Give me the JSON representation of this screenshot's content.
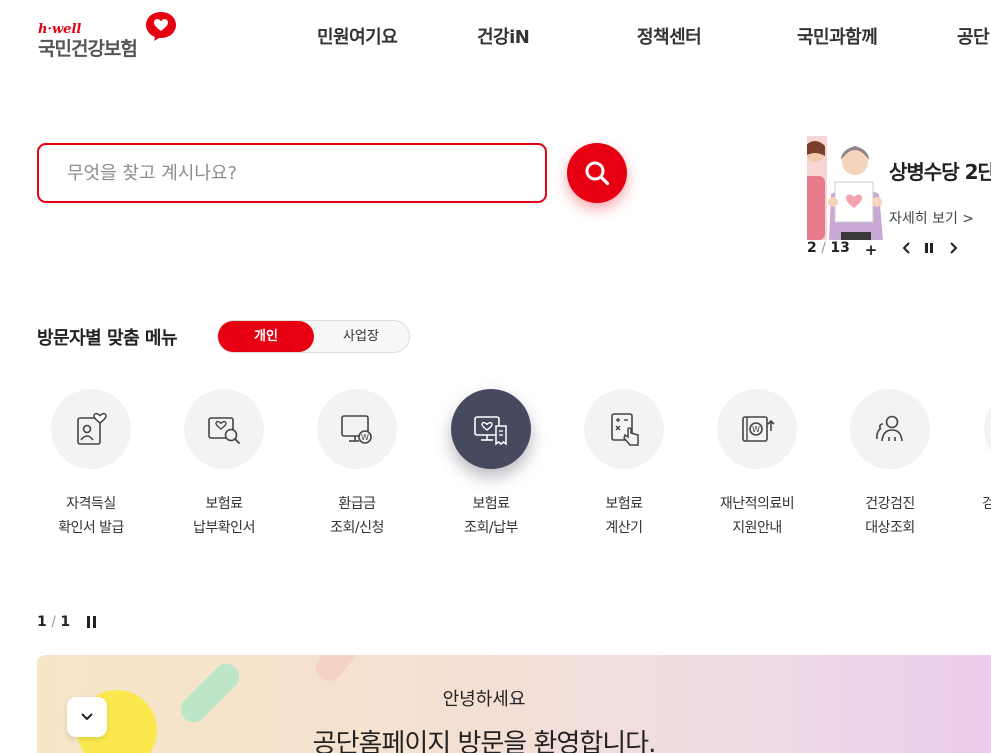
{
  "header": {
    "logo": {
      "tagline": "h·well",
      "name": "국민건강보험"
    },
    "nav": [
      "민원여기요",
      "건강iN",
      "정책센터",
      "국민과함께",
      "공단"
    ]
  },
  "search": {
    "placeholder": "무엇을 찾고 계시나요?",
    "button_icon": "search-icon"
  },
  "banner": {
    "title": "상병수당 2단",
    "link": "자세히 보기 >",
    "current": "2",
    "total": "13",
    "controls": {
      "add": "+",
      "prev": "‹",
      "next": "›"
    }
  },
  "visitor_menu": {
    "title": "방문자별 맞춤 메뉴",
    "tabs": {
      "personal": "개인",
      "business": "사업장"
    },
    "items": [
      {
        "line1": "자격득실",
        "line2": "확인서 발급",
        "icon": "id-card-heart-icon"
      },
      {
        "line1": "보험료",
        "line2": "납부확인서",
        "icon": "document-search-icon"
      },
      {
        "line1": "환급금",
        "line2": "조회/신청",
        "icon": "monitor-won-icon"
      },
      {
        "line1": "보험료",
        "line2": "조회/납부",
        "icon": "monitor-receipt-icon"
      },
      {
        "line1": "보험료",
        "line2": "계산기",
        "icon": "calculator-hand-icon"
      },
      {
        "line1": "재난적의료비",
        "line2": "지원안내",
        "icon": "safe-won-icon"
      },
      {
        "line1": "건강검진",
        "line2": "대상조회",
        "icon": "people-icon"
      },
      {
        "line1": "",
        "line2": "검",
        "icon": ""
      }
    ]
  },
  "notice": {
    "current": "1",
    "total": "1"
  },
  "welcome": {
    "greeting": "안녕하세요",
    "message": "공단홈페이지 방문을 환영합니다."
  },
  "colors": {
    "accent": "#e60012",
    "active_icon_bg": "#474a5e"
  }
}
